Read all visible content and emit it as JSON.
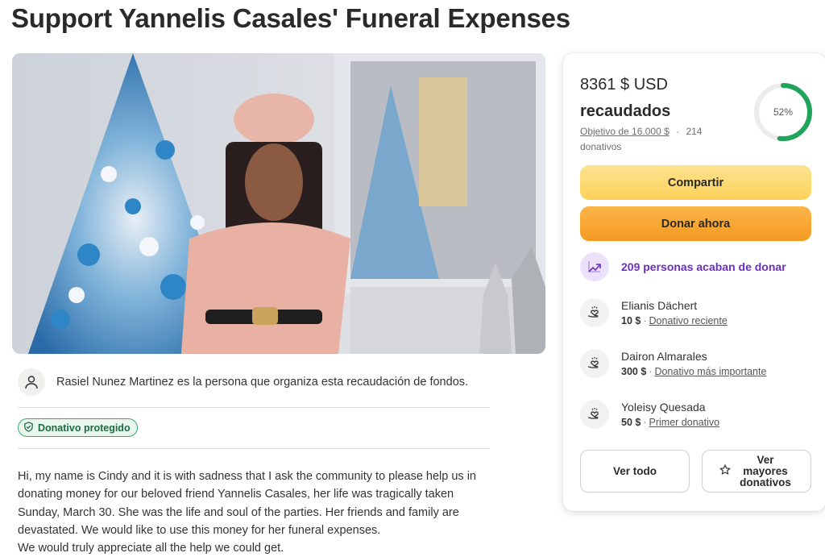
{
  "page": {
    "title": "Support Yannelis Casales' Funeral Expenses"
  },
  "organizer": {
    "text": "Rasiel Nunez Martinez es la persona que organiza esta recaudación de fondos."
  },
  "badge": {
    "label": "Donativo protegido"
  },
  "story": {
    "lines": [
      "Hi, my name is Cindy and it is with sadness that I ask the community to please help us in",
      "donating money for our beloved friend Yannelis Casales, her life was tragically taken",
      "Sunday, March 30. She was the life and soul of the parties. Her friends and family are",
      "devastated. We would like to use this money for her funeral expenses.",
      "We would truly appreciate all the help we could get."
    ]
  },
  "donation_card": {
    "amount": "8361 $ USD",
    "raised_label": "recaudados",
    "goal": "Objetivo de 16.000 $",
    "separator": "·",
    "donations_count": "214",
    "donations_label": "donativos",
    "progress_percent_label": "52%",
    "progress_fraction": 0.52,
    "share_button": "Compartir",
    "donate_button": "Donar ahora",
    "recent_activity": "209 personas acaban de donar",
    "donors": [
      {
        "name": "Elianis Dächert",
        "amount": "10 $",
        "tag": "Donativo reciente"
      },
      {
        "name": "Dairon Almarales",
        "amount": "300 $",
        "tag": "Donativo más importante"
      },
      {
        "name": "Yoleisy Quesada",
        "amount": "50 $",
        "tag": "Primer donativo"
      }
    ],
    "see_all_button": "Ver todo",
    "top_donations_button": "Ver mayores donativos"
  },
  "colors": {
    "progress": "#20a35a",
    "share_button": "#fbd159",
    "donate_button": "#f59a22",
    "recent_activity_text": "#6b2fc0",
    "badge_border": "#39a96b"
  },
  "icons": {
    "organizer": "user-icon",
    "badge": "shield-check-icon",
    "recent": "trending-up-icon",
    "donor": "heart-hand-icon",
    "top_donations": "star-icon"
  }
}
